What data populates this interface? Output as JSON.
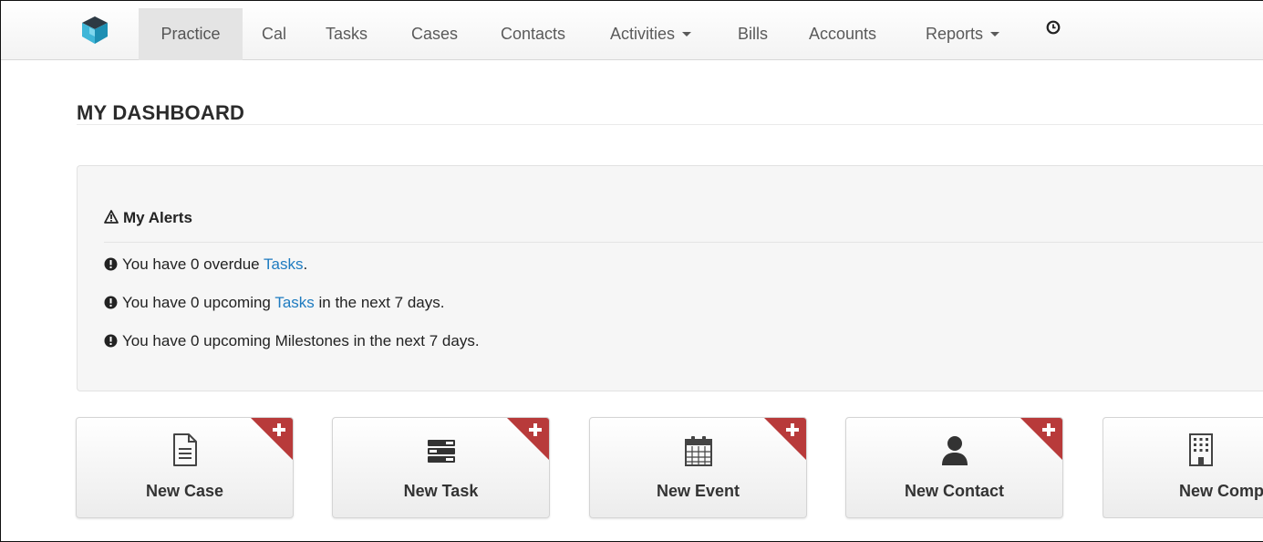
{
  "nav": {
    "items": [
      {
        "label": "Practice",
        "active": true
      },
      {
        "label": "Cal"
      },
      {
        "label": "Tasks"
      },
      {
        "label": "Cases"
      },
      {
        "label": "Contacts"
      },
      {
        "label": "Activities",
        "dropdown": true
      },
      {
        "label": "Bills"
      },
      {
        "label": "Accounts"
      },
      {
        "label": "Reports",
        "dropdown": true
      }
    ],
    "clock_icon": "clock-icon",
    "logo_icon": "cube-logo-icon"
  },
  "page": {
    "title": "MY DASHBOARD"
  },
  "alerts": {
    "heading": "My Alerts",
    "heading_icon": "warning-triangle-icon",
    "lines": [
      {
        "prefix": "You have 0 overdue ",
        "link": "Tasks",
        "suffix": "."
      },
      {
        "prefix": "You have 0 upcoming ",
        "link": "Tasks",
        "suffix": " in the next 7 days."
      },
      {
        "prefix": "You have 0 upcoming Milestones in the next 7 days.",
        "link": "",
        "suffix": ""
      }
    ],
    "line_icon": "exclamation-circle-icon"
  },
  "tiles": [
    {
      "label": "New Case",
      "icon": "document-icon"
    },
    {
      "label": "New Task",
      "icon": "task-list-icon"
    },
    {
      "label": "New Event",
      "icon": "calendar-icon"
    },
    {
      "label": "New Contact",
      "icon": "person-icon"
    },
    {
      "label": "New Compar",
      "icon": "building-icon"
    }
  ],
  "colors": {
    "link": "#1e7bc0",
    "corner_badge": "#b83a3a",
    "active_nav_bg": "#e4e4e4"
  }
}
